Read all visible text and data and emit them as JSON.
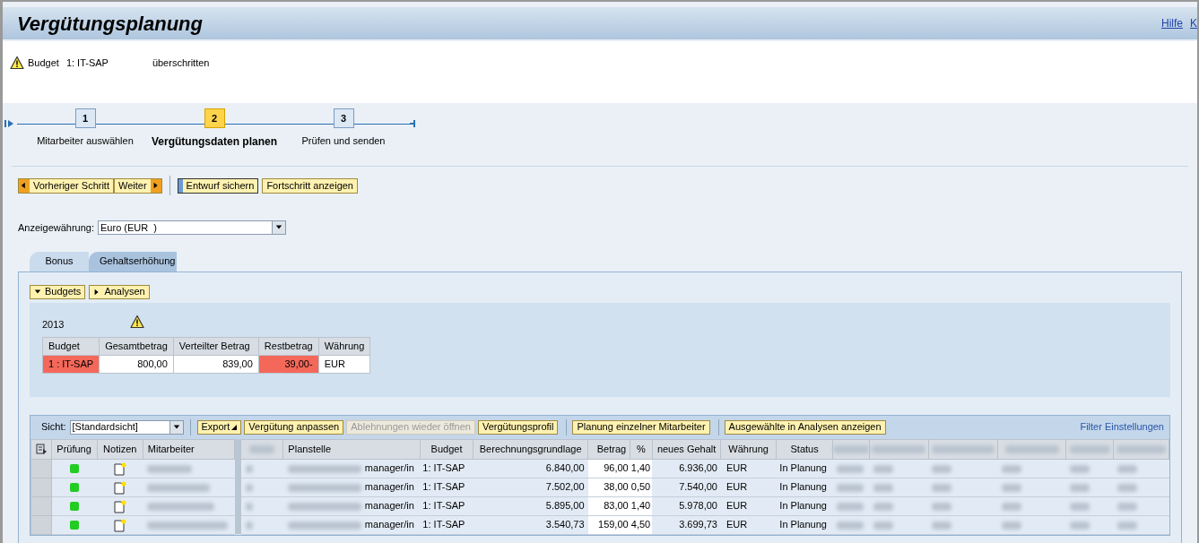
{
  "header": {
    "title": "Vergütungsplanung",
    "links": [
      "Hilfe",
      "K"
    ]
  },
  "message": {
    "label": "Budget",
    "budget": "1: IT-SAP",
    "text": "überschritten"
  },
  "steps": [
    {
      "number": "1",
      "label": "Mitarbeiter auswählen",
      "selected": false
    },
    {
      "number": "2",
      "label": "Vergütungsdaten planen",
      "selected": true
    },
    {
      "number": "3",
      "label": "Prüfen und senden",
      "selected": false
    }
  ],
  "toolbar": [
    {
      "kind": "prev",
      "label": "Vorheriger Schritt"
    },
    {
      "kind": "next",
      "label": "Weiter"
    },
    {
      "kind": "separator"
    },
    {
      "kind": "save",
      "label": "Entwurf sichern"
    },
    {
      "kind": "plain",
      "label": "Fortschritt anzeigen"
    }
  ],
  "currency": {
    "label": "Anzeigewährung:",
    "value": "Euro (EUR  )"
  },
  "tabs": [
    {
      "label": "Bonus",
      "selected": false
    },
    {
      "label": "Gehaltserhöhung",
      "selected": true
    }
  ],
  "sections": [
    {
      "label": "Budgets",
      "expanded": true
    },
    {
      "label": "Analysen",
      "expanded": false
    }
  ],
  "budget": {
    "year": "2013",
    "warning": true,
    "columns": [
      "Budget",
      "Gesamtbetrag",
      "Verteilter Betrag",
      "Restbetrag",
      "Währung"
    ],
    "rows": [
      [
        {
          "text": "1 : IT-SAP",
          "alert": true
        },
        {
          "text": "800,00",
          "alert": false
        },
        {
          "text": "839,00",
          "alert": false
        },
        {
          "text": "39,00-",
          "alert": true
        },
        {
          "text": "EUR",
          "alert": false
        }
      ]
    ]
  },
  "grid": {
    "view": {
      "label": "Sicht:",
      "value": "[Standardsicht]"
    },
    "buttons": [
      {
        "label": "Export",
        "menu": true,
        "disabled": false
      },
      {
        "label": "Vergütung anpassen",
        "menu": false,
        "disabled": false
      },
      {
        "label": "Ablehnungen wieder öffnen",
        "menu": false,
        "disabled": true
      },
      {
        "label": "Vergütungsprofil",
        "menu": false,
        "disabled": false
      },
      {
        "label": "Planung einzelner Mitarbeiter",
        "menu": false,
        "disabled": false
      },
      {
        "label": "Ausgewählte in Analysen anzeigen",
        "menu": false,
        "disabled": false
      }
    ],
    "filter_link": "Filter Einstellungen",
    "columns": [
      "Prüfung",
      "Notizen",
      "Mitarbeiter",
      "Planstelle",
      "Budget",
      "Berechnungsgrundlage",
      "Betrag",
      "%",
      "neues Gehalt",
      "Währung",
      "Status"
    ],
    "rows": [
      {
        "color": "#22cc22",
        "position": "manager/in",
        "budget": "1: IT-SAP",
        "basis": "6.840,00",
        "amount": "96,00",
        "percent": "1,40",
        "new_salary": "6.936,00",
        "currency": "EUR",
        "status": "In Planung"
      },
      {
        "color": "#22cc22",
        "position": "manager/in",
        "budget": "1: IT-SAP",
        "basis": "7.502,00",
        "amount": "38,00",
        "percent": "0,50",
        "new_salary": "7.540,00",
        "currency": "EUR",
        "status": "In Planung"
      },
      {
        "color": "#22cc22",
        "position": "manager/in",
        "budget": "1: IT-SAP",
        "basis": "5.895,00",
        "amount": "83,00",
        "percent": "1,40",
        "new_salary": "5.978,00",
        "currency": "EUR",
        "status": "In Planung"
      },
      {
        "color": "#22cc22",
        "position": "manager/in",
        "budget": "1: IT-SAP",
        "basis": "3.540,73",
        "amount": "159,00",
        "percent": "4,50",
        "new_salary": "3.699,73",
        "currency": "EUR",
        "status": "In Planung"
      }
    ]
  }
}
